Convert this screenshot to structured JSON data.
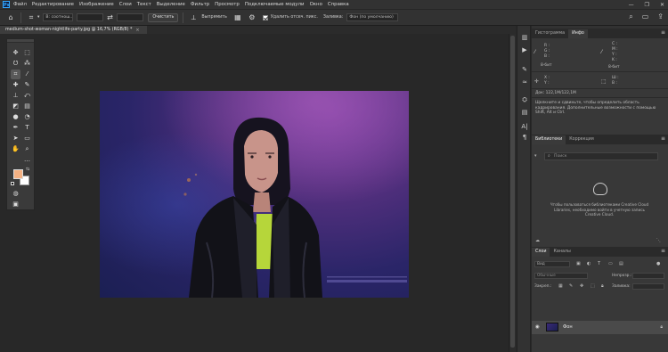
{
  "app": {
    "logo": "Ps"
  },
  "menu": [
    "Файл",
    "Редактирование",
    "Изображение",
    "Слои",
    "Текст",
    "Выделение",
    "Фильтр",
    "Просмотр",
    "Подключаемые модули",
    "Окно",
    "Справка"
  ],
  "window_controls": [
    "—",
    "❐",
    "✕"
  ],
  "options_bar": {
    "ratio": "В: соотнош...",
    "ratio_w": "",
    "ratio_h": "",
    "clear_label": "Очистить",
    "straighten_label": "Выпрямить",
    "delete_cropped_label": "Удалить отсеч. пикс.",
    "content_aware_label": "Заливка:",
    "fill_value": "Фон (по умолчанию)"
  },
  "document": {
    "tab_title": "medium-shot-woman-nightlife-party.jpg @ 16,7% (RGB/8) *",
    "close": "×"
  },
  "info_panel": {
    "tabs": [
      "Гистограмма",
      "Инфо"
    ],
    "active": "Инфо",
    "r": "R :",
    "g": "G :",
    "b": "B :",
    "c": "C :",
    "m": "M :",
    "y": "Y :",
    "k": "K :",
    "bits_left": "8-бит",
    "bits_right": "8-бит",
    "x": "X :",
    "y_coord": "Y :",
    "w": "Ш :",
    "h": "В :",
    "doc_size": "Док: 122,1M/122,1M",
    "hint": "Щелкните и сдвиньте, чтобы определить область кадрирования. Дополнительные возможности с помощью Shift, Alt и Ctrl."
  },
  "libraries_panel": {
    "tabs": [
      "Библиотеки",
      "Коррекция"
    ],
    "search_placeholder": "Поиск",
    "message": "Чтобы пользоваться библиотеками Creative Cloud Libraries, необходимо войти в учетную запись Creative Cloud."
  },
  "layers_panel": {
    "tabs": [
      "Слои",
      "Каналы"
    ],
    "search_placeholder": "Вид",
    "blend_mode": "Обычные",
    "opacity_label": "Непрозр.:",
    "lock_label": "Закреп.:",
    "fill_label": "Заливка:",
    "layer_name": "Фон"
  }
}
